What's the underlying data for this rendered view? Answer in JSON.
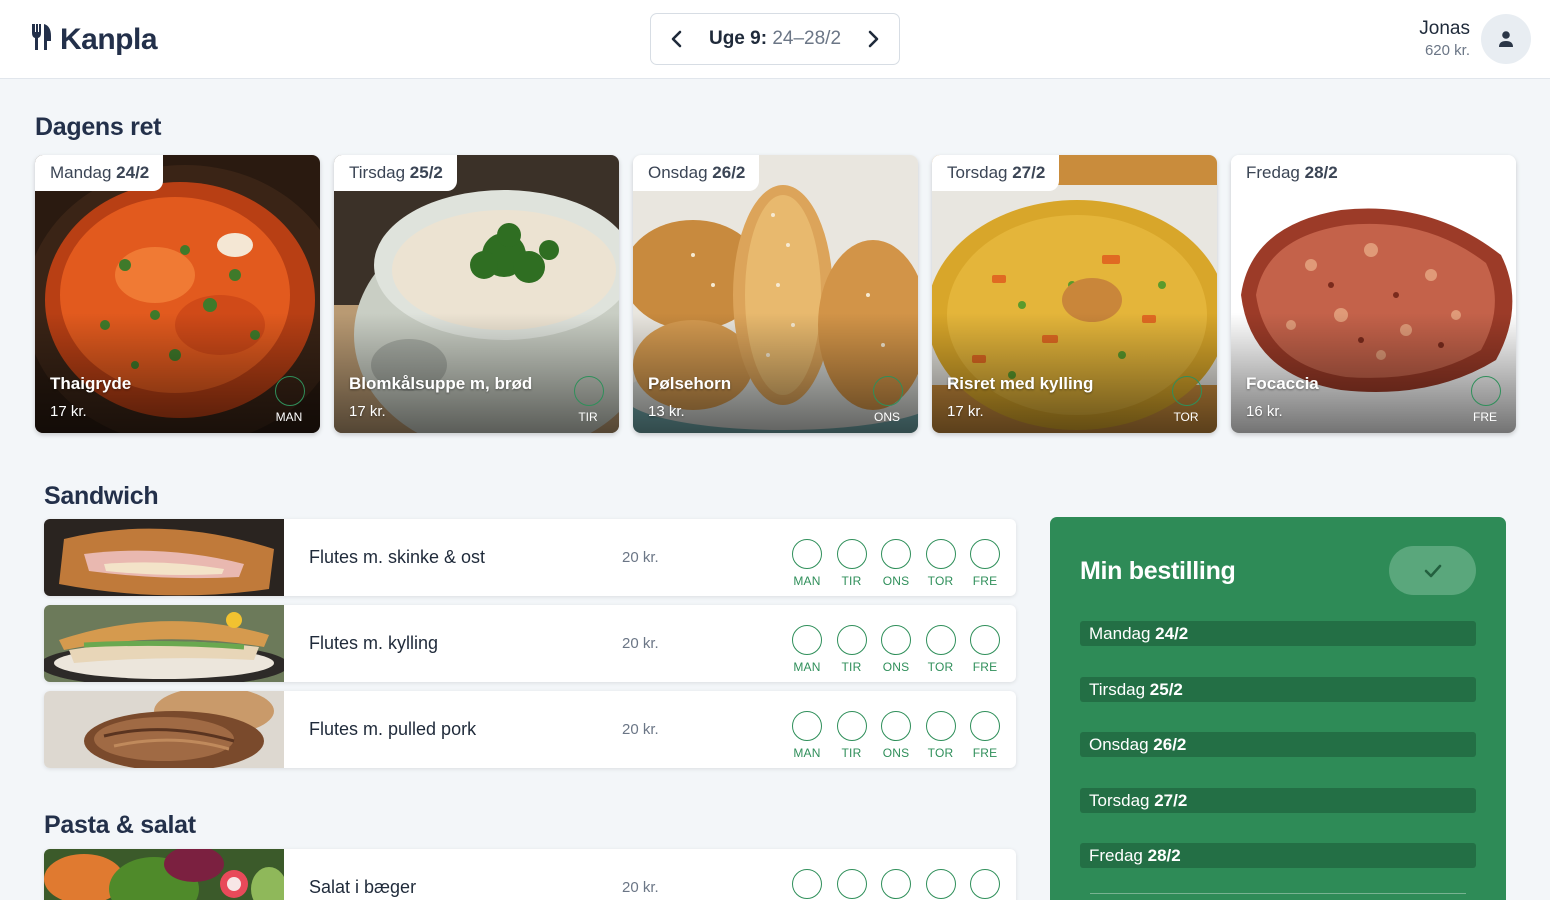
{
  "app": {
    "name": "Kanpla"
  },
  "week": {
    "label": "Uge 9:",
    "range": "24–28/2"
  },
  "user": {
    "name": "Jonas",
    "balance": "620 kr."
  },
  "sections": {
    "dagens_ret": "Dagens ret",
    "sandwich": "Sandwich",
    "pasta_salat": "Pasta & salat"
  },
  "day_cards": [
    {
      "weekday": "Mandag",
      "date": "24/2",
      "dish": "Thaigryde",
      "price": "17 kr.",
      "day_short": "MAN"
    },
    {
      "weekday": "Tirsdag",
      "date": "25/2",
      "dish": "Blomkålsuppe m, brød",
      "price": "17 kr.",
      "day_short": "TIR"
    },
    {
      "weekday": "Onsdag",
      "date": "26/2",
      "dish": "Pølsehorn",
      "price": "13 kr.",
      "day_short": "ONS"
    },
    {
      "weekday": "Torsdag",
      "date": "27/2",
      "dish": "Risret med kylling",
      "price": "17 kr.",
      "day_short": "TOR"
    },
    {
      "weekday": "Fredag",
      "date": "28/2",
      "dish": "Focaccia",
      "price": "16 kr.",
      "day_short": "FRE"
    }
  ],
  "day_labels": [
    "MAN",
    "TIR",
    "ONS",
    "TOR",
    "FRE"
  ],
  "sandwich_items": [
    {
      "name": "Flutes m. skinke & ost",
      "price": "20 kr."
    },
    {
      "name": "Flutes m. kylling",
      "price": "20 kr."
    },
    {
      "name": "Flutes m. pulled pork",
      "price": "20 kr."
    }
  ],
  "pasta_items": [
    {
      "name": "Salat i bæger",
      "price": "20 kr."
    }
  ],
  "order": {
    "title": "Min bestilling",
    "days": [
      {
        "weekday": "Mandag",
        "date": "24/2"
      },
      {
        "weekday": "Tirsdag",
        "date": "25/2"
      },
      {
        "weekday": "Onsdag",
        "date": "26/2"
      },
      {
        "weekday": "Torsdag",
        "date": "27/2"
      },
      {
        "weekday": "Fredag",
        "date": "28/2"
      }
    ]
  },
  "colors": {
    "accent": "#2e8b57",
    "accent_dark": "#236f45",
    "text": "#1f2a3a",
    "muted": "#6b7686"
  }
}
